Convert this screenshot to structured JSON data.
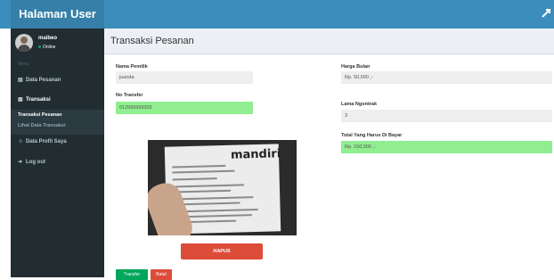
{
  "app": {
    "title": "Halaman User"
  },
  "user": {
    "name": "maibeo",
    "status": "Online"
  },
  "sidebar": {
    "header": "Menu",
    "items": [
      {
        "label": "Data Pesanan",
        "icon": "cart-icon"
      },
      {
        "label": "Transaksi",
        "icon": "table-icon"
      },
      {
        "label": "Data Profil Saya",
        "icon": "user-icon"
      },
      {
        "label": "Log out",
        "icon": "logout-icon"
      }
    ],
    "subitems": [
      {
        "label": "Transaksi Pesanan"
      },
      {
        "label": "Lihat Data Transaksi"
      }
    ]
  },
  "page": {
    "title": "Transaksi Pesanan"
  },
  "form": {
    "nama_label": "Nama Pemilik",
    "nama_value": "juanda",
    "transfer_label": "No Transfer",
    "transfer_value": "012589999302",
    "harga_label": "Harga Bulan",
    "harga_value": "Rp. 50,000 ,-",
    "lama_label": "Lama Ngontrak",
    "lama_value": "3",
    "total_label": "Total Yang Harus Di Bayar",
    "total_value": "Rp. 150,000 ,-"
  },
  "receipt": {
    "brand": "mandiri"
  },
  "buttons": {
    "hapus": "HAPUS",
    "transfer": "Transfer",
    "batal": "Batal"
  },
  "colors": {
    "header": "#3c8dbc",
    "sidebar": "#222d32",
    "green_field": "#90ee90",
    "danger": "#dd4b39",
    "success": "#00a65a"
  }
}
